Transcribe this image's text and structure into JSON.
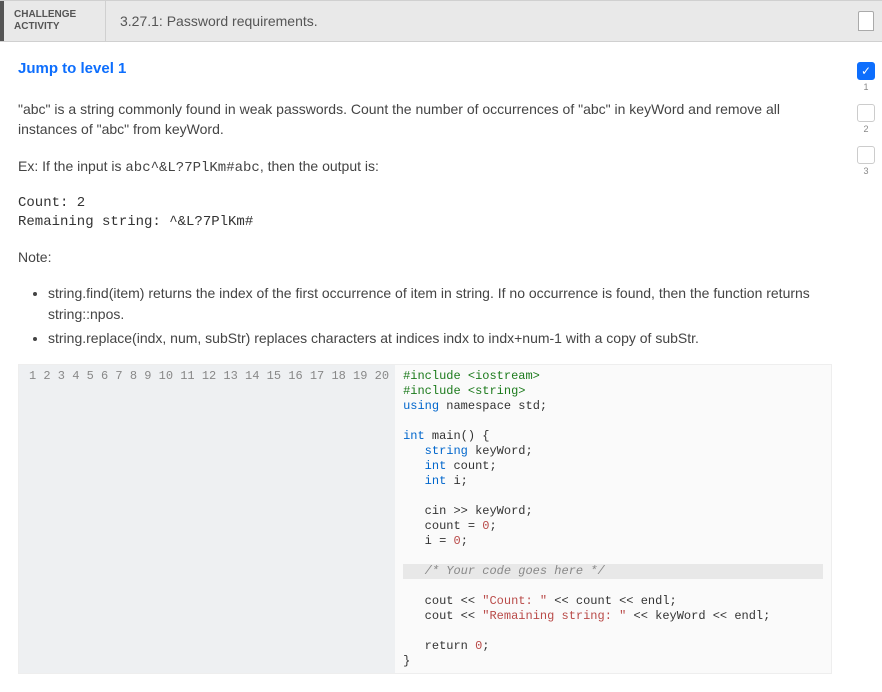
{
  "header": {
    "label_line1": "CHALLENGE",
    "label_line2": "ACTIVITY",
    "title": "3.27.1: Password requirements."
  },
  "jump_text": "Jump to level 1",
  "intro": "\"abc\" is a string commonly found in weak passwords. Count the number of occurrences of \"abc\" in keyWord and remove all instances of \"abc\" from keyWord.",
  "example_prefix": "Ex: If the input is ",
  "example_input": "abc^&L?7PlKm#abc",
  "example_suffix": ", then the output is:",
  "output_block": "Count: 2\nRemaining string: ^&L?7PlKm#",
  "note_label": "Note:",
  "notes": [
    "string.find(item) returns the index of the first occurrence of item in string. If no occurrence is found, then the function returns string::npos.",
    "string.replace(indx, num, subStr) replaces characters at indices indx to indx+num-1 with a copy of subStr."
  ],
  "code": {
    "line_count": 20,
    "l1_a": "#include ",
    "l1_b": "<iostream>",
    "l2_a": "#include ",
    "l2_b": "<string>",
    "l3_a": "using",
    "l3_b": " namespace std;",
    "l5_a": "int",
    "l5_b": " main() {",
    "l6_a": "   string",
    "l6_b": " keyWord;",
    "l7_a": "   int",
    "l7_b": " count;",
    "l8_a": "   int",
    "l8_b": " i;",
    "l10": "   cin >> keyWord;",
    "l11_a": "   count = ",
    "l11_b": "0",
    "l11_c": ";",
    "l12_a": "   i = ",
    "l12_b": "0",
    "l12_c": ";",
    "l14": "   /* Your code goes here */",
    "l16_a": "   cout << ",
    "l16_b": "\"Count: \"",
    "l16_c": " << count << endl;",
    "l17_a": "   cout << ",
    "l17_b": "\"Remaining string: \"",
    "l17_c": " << keyWord << endl;",
    "l19_a": "   return ",
    "l19_b": "0",
    "l19_c": ";",
    "l20": "}"
  },
  "steps": [
    {
      "n": "1",
      "active": true,
      "check": "✓"
    },
    {
      "n": "2",
      "active": false,
      "check": ""
    },
    {
      "n": "3",
      "active": false,
      "check": ""
    }
  ]
}
